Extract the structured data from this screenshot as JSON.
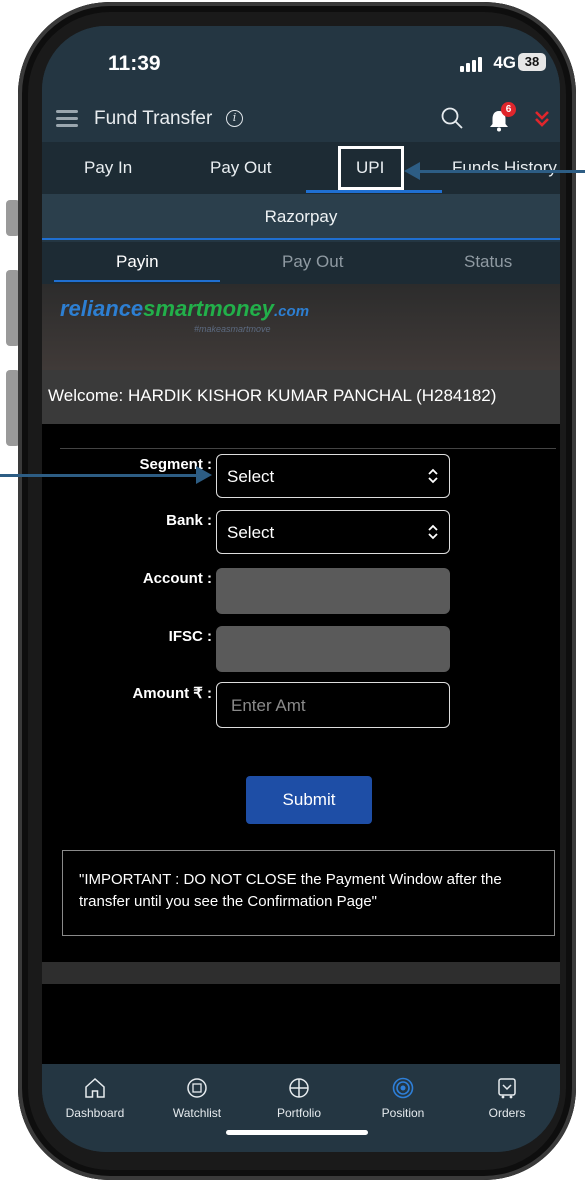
{
  "status": {
    "time": "11:39",
    "network": "4G",
    "battery": "38"
  },
  "header": {
    "title": "Fund Transfer",
    "notification_count": "6"
  },
  "top_tabs": [
    {
      "label": "Pay In"
    },
    {
      "label": "Pay Out"
    },
    {
      "label": "UPI"
    },
    {
      "label": "Funds History"
    }
  ],
  "gateway": {
    "label": "Razorpay"
  },
  "sub_tabs": [
    {
      "label": "Payin"
    },
    {
      "label": "Pay Out"
    },
    {
      "label": "Status"
    }
  ],
  "banner": {
    "brand_part1": "reliance",
    "brand_part2": "smartmoney",
    "brand_part3": ".com",
    "tagline": "#makeasmartmove"
  },
  "welcome": "Welcome: HARDIK KISHOR KUMAR PANCHAL (H284182)",
  "form": {
    "segment_label": "Segment :",
    "segment_value": "Select",
    "bank_label": "Bank :",
    "bank_value": "Select",
    "account_label": "Account :",
    "ifsc_label": "IFSC :",
    "amount_label": "Amount ₹ :",
    "amount_placeholder": "Enter Amt",
    "submit_label": "Submit",
    "notice": "\"IMPORTANT : DO NOT CLOSE the Payment Window after the transfer until you see the Confirmation Page\""
  },
  "bottom_nav": [
    {
      "label": "Dashboard",
      "icon": "home-icon"
    },
    {
      "label": "Watchlist",
      "icon": "watchlist-icon"
    },
    {
      "label": "Portfolio",
      "icon": "portfolio-icon"
    },
    {
      "label": "Position",
      "icon": "position-icon"
    },
    {
      "label": "Orders",
      "icon": "orders-icon"
    }
  ],
  "colors": {
    "accent": "#1f6fd1",
    "header_bg": "#243642",
    "submit_bg": "#1e4ea6",
    "badge": "#e0262c",
    "active_nav": "#2e7fd8"
  }
}
